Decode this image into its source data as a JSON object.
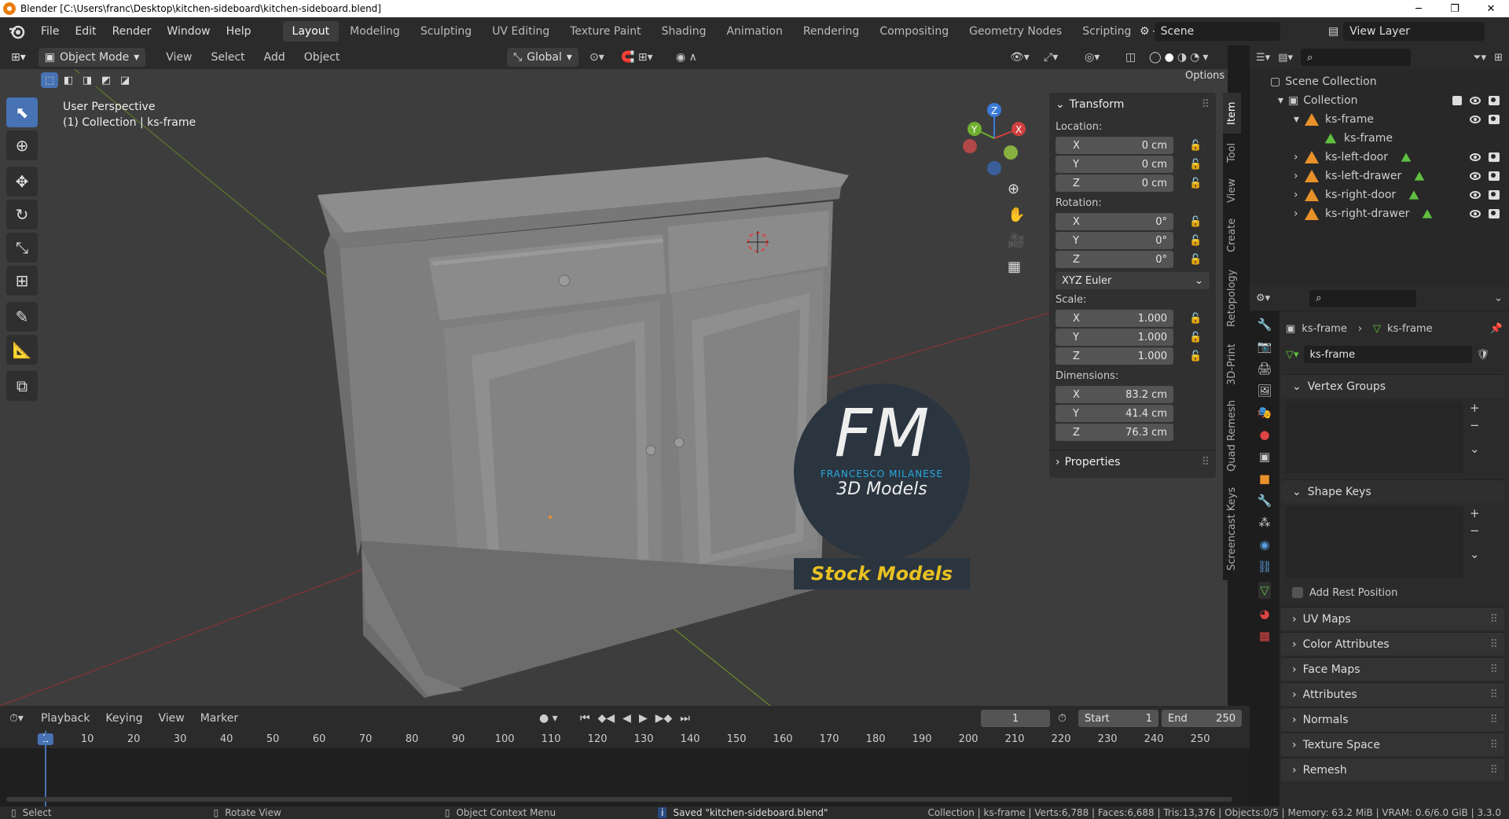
{
  "window": {
    "title": "Blender [C:\\Users\\franc\\Desktop\\kitchen-sideboard\\kitchen-sideboard.blend]",
    "min": "─",
    "max": "❐",
    "close": "✕"
  },
  "menu": {
    "items": [
      "File",
      "Edit",
      "Render",
      "Window",
      "Help"
    ]
  },
  "workspaces": [
    "Layout",
    "Modeling",
    "Sculpting",
    "UV Editing",
    "Texture Paint",
    "Shading",
    "Animation",
    "Rendering",
    "Compositing",
    "Geometry Nodes",
    "Scripting"
  ],
  "active_workspace": "Layout",
  "scene": {
    "label": "Scene",
    "view_layer": "View Layer"
  },
  "viewport_header": {
    "mode": "Object Mode",
    "menus": [
      "View",
      "Select",
      "Add",
      "Object"
    ],
    "orientation": "Global",
    "options": "Options"
  },
  "viewport": {
    "perspective": "User Perspective",
    "collection_info": "(1) Collection | ks-frame",
    "axes": {
      "x": "X",
      "y": "Y",
      "z": "Z"
    }
  },
  "watermark": {
    "brand": "FM",
    "name": "FRANCESCO MILANESE",
    "sub": "3D Models",
    "tag": "Stock Models"
  },
  "npanel": {
    "transform_title": "Transform",
    "location_label": "Location:",
    "location": [
      {
        "axis": "X",
        "value": "0 cm"
      },
      {
        "axis": "Y",
        "value": "0 cm"
      },
      {
        "axis": "Z",
        "value": "0 cm"
      }
    ],
    "rotation_label": "Rotation:",
    "rotation": [
      {
        "axis": "X",
        "value": "0°"
      },
      {
        "axis": "Y",
        "value": "0°"
      },
      {
        "axis": "Z",
        "value": "0°"
      }
    ],
    "rotation_mode": "XYZ Euler",
    "scale_label": "Scale:",
    "scale": [
      {
        "axis": "X",
        "value": "1.000"
      },
      {
        "axis": "Y",
        "value": "1.000"
      },
      {
        "axis": "Z",
        "value": "1.000"
      }
    ],
    "dimensions_label": "Dimensions:",
    "dimensions": [
      {
        "axis": "X",
        "value": "83.2 cm"
      },
      {
        "axis": "Y",
        "value": "41.4 cm"
      },
      {
        "axis": "Z",
        "value": "76.3 cm"
      }
    ],
    "properties_title": "Properties",
    "tabs": [
      "Item",
      "Tool",
      "View",
      "Create",
      "Retopology",
      "3D-Print",
      "Quad Remesh",
      "Screencast Keys"
    ]
  },
  "outliner": {
    "root": "Scene Collection",
    "collection": "Collection",
    "items": [
      {
        "name": "ks-frame",
        "level": 1,
        "type": "object"
      },
      {
        "name": "ks-frame",
        "level": 2,
        "type": "mesh"
      },
      {
        "name": "ks-left-door",
        "level": 1,
        "type": "object"
      },
      {
        "name": "ks-left-drawer",
        "level": 1,
        "type": "object"
      },
      {
        "name": "ks-right-door",
        "level": 1,
        "type": "object"
      },
      {
        "name": "ks-right-drawer",
        "level": 1,
        "type": "object"
      }
    ]
  },
  "properties": {
    "breadcrumb_object": "ks-frame",
    "breadcrumb_data": "ks-frame",
    "mesh_name": "ks-frame",
    "vertex_groups": "Vertex Groups",
    "shape_keys": "Shape Keys",
    "add_rest_position": "Add Rest Position",
    "sections": [
      "UV Maps",
      "Color Attributes",
      "Face Maps",
      "Attributes",
      "Normals",
      "Texture Space",
      "Remesh"
    ]
  },
  "timeline": {
    "menus": [
      "Playback",
      "Keying",
      "View",
      "Marker"
    ],
    "current_frame": "1",
    "start_label": "Start",
    "start": "1",
    "end_label": "End",
    "end": "250",
    "ticks": [
      "1",
      "10",
      "20",
      "30",
      "40",
      "50",
      "60",
      "70",
      "80",
      "90",
      "100",
      "110",
      "120",
      "130",
      "140",
      "150",
      "160",
      "170",
      "180",
      "190",
      "200",
      "210",
      "220",
      "230",
      "240",
      "250"
    ]
  },
  "status": {
    "select": "Select",
    "rotate": "Rotate View",
    "context": "Object Context Menu",
    "saved": "Saved \"kitchen-sideboard.blend\"",
    "stats": "Collection | ks-frame | Verts:6,788 | Faces:6,688 | Tris:13,376 | Objects:0/5 | Memory: 63.2 MiB | VRAM: 0.6/6.0 GiB | 3.3.0"
  },
  "colors": {
    "accent": "#4772b3",
    "object": "#e8902a",
    "mesh": "#60c040"
  }
}
